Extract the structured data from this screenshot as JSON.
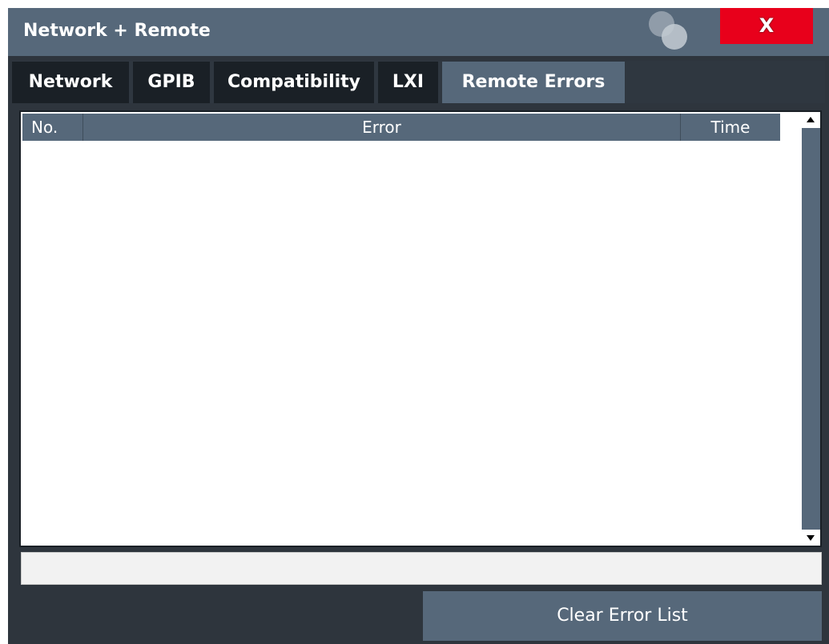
{
  "window": {
    "title": "Network + Remote",
    "close_label": "X"
  },
  "tabs": [
    {
      "label": "Network",
      "active": false
    },
    {
      "label": "GPIB",
      "active": false
    },
    {
      "label": "Compatibility",
      "active": false
    },
    {
      "label": "LXI",
      "active": false
    },
    {
      "label": "Remote Errors",
      "active": true
    }
  ],
  "error_table": {
    "columns": [
      "No.",
      "Error",
      "Time"
    ],
    "rows": []
  },
  "status_field": {
    "value": ""
  },
  "clear_button": {
    "label": "Clear Error List"
  },
  "icons": {
    "logo": "overlapping-circles-icon",
    "close": "close-icon",
    "scroll_up": "arrow-up-icon",
    "scroll_down": "arrow-down-icon"
  },
  "colors": {
    "title_bar": "#56687a",
    "close_button": "#e8001b",
    "tab_active": "#56687a",
    "tab_inactive": "#1a2026",
    "background": "#2e353d"
  }
}
